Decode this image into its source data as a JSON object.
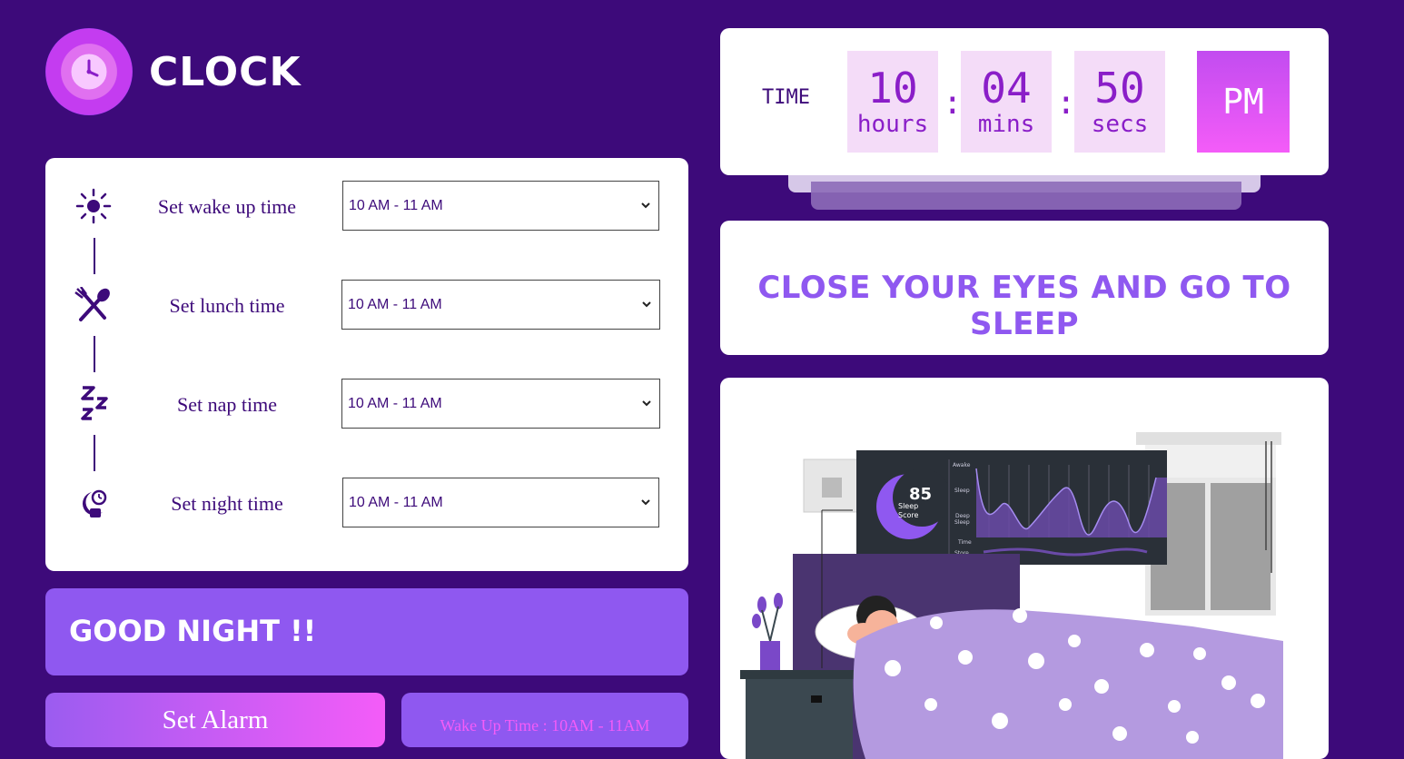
{
  "app": {
    "title": "CLOCK"
  },
  "schedule": {
    "rows": [
      {
        "label": "Set wake up time",
        "value": "10 AM - 11 AM",
        "icon": "sun-icon"
      },
      {
        "label": "Set lunch time",
        "value": "10 AM - 11 AM",
        "icon": "fork-spoon-icon"
      },
      {
        "label": "Set nap time",
        "value": "10 AM - 11 AM",
        "icon": "zzz-icon"
      },
      {
        "label": "Set night time",
        "value": "10 AM - 11 AM",
        "icon": "moon-clock-icon"
      }
    ]
  },
  "banner": {
    "text": "GOOD NIGHT !!"
  },
  "actions": {
    "set_alarm": "Set Alarm",
    "wake_info": "Wake Up Time : 10AM - 11AM"
  },
  "time": {
    "label": "TIME",
    "hours": "10",
    "hours_unit": "hours",
    "mins": "04",
    "mins_unit": "mins",
    "secs": "50",
    "secs_unit": "secs",
    "period": "PM"
  },
  "message": {
    "text": "CLOSE YOUR EYES AND GO TO SLEEP"
  },
  "illustration": {
    "score": "85",
    "score_line1": "Sleep",
    "score_line2": "Score",
    "chart_labels": [
      "Awake",
      "Sleep",
      "Deep",
      "Sleep",
      "Time",
      "Store"
    ]
  },
  "colors": {
    "background": "#3d0a7a",
    "accent": "#8f58f0",
    "pink": "#f45cf8"
  }
}
